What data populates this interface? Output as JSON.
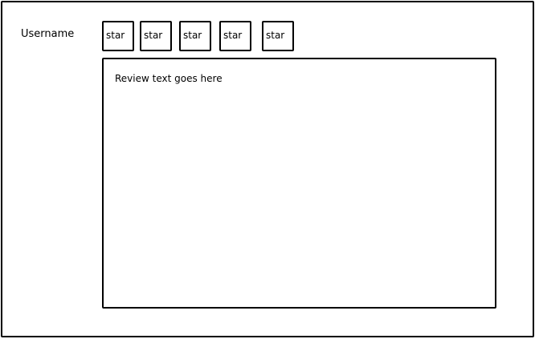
{
  "form": {
    "username_label": "Username",
    "rating": {
      "stars": [
        "star",
        "star",
        "star",
        "star",
        "star"
      ]
    },
    "review": {
      "text": "Review text goes here"
    }
  }
}
